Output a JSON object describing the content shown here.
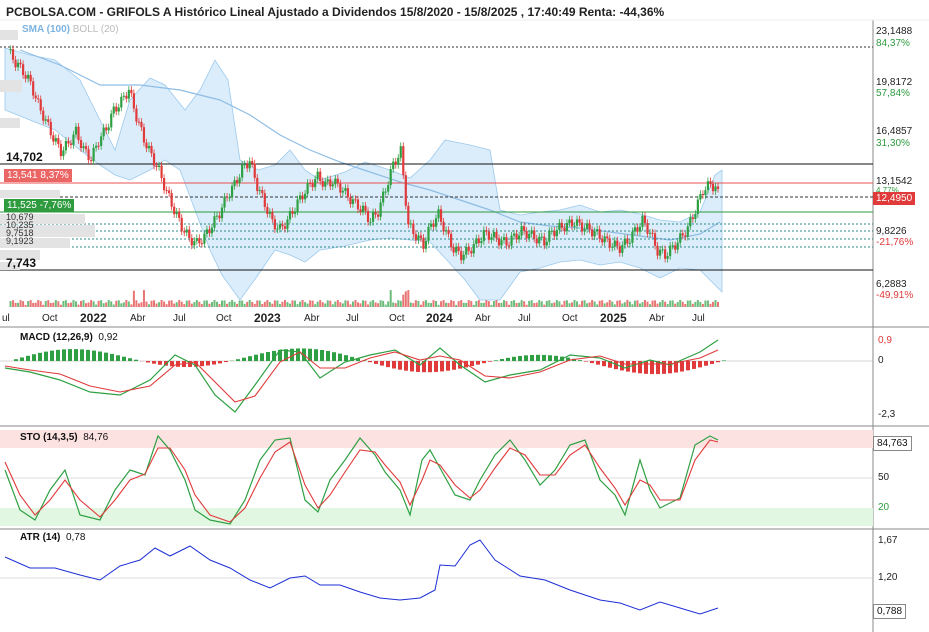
{
  "title": "PCBOLSA.COM - GRIFOLS A Histórico Lineal Ajustado a Dividendos 15/8/2020 - 15/8/2025 , 17:40:49 Renta: -44,36%",
  "overlay_legend": {
    "sma": "SMA (100)",
    "boll": "BOLL (20)"
  },
  "price_axis": [
    {
      "value": "23,1488",
      "pct": "84,37%",
      "pct_color": "#2e9b3e"
    },
    {
      "value": "19,8172",
      "pct": "57,84%",
      "pct_color": "#2e9b3e"
    },
    {
      "value": "16,4857",
      "pct": "31,30%",
      "pct_color": "#2e9b3e"
    },
    {
      "value": "13,1542",
      "pct": "4,77%",
      "pct_color": "#2e9b3e"
    },
    {
      "value": "9,8226",
      "pct": "-21,76%",
      "pct_color": "#e03a3a"
    },
    {
      "value": "6,2883",
      "pct": "-49,91%",
      "pct_color": "#e03a3a"
    }
  ],
  "last_price": "12,4950",
  "levels": {
    "high": "14,702",
    "low": "7,743",
    "red_box": "13,541  8,37%",
    "green_box": "11,525  -7,76%",
    "fib1": "10,679",
    "fib2": "10,235",
    "fib3": "9,7518",
    "fib4": "9,1923"
  },
  "x_axis": [
    "ul",
    "Oct",
    "2022",
    "Abr",
    "Jul",
    "Oct",
    "2023",
    "Abr",
    "Jul",
    "Oct",
    "2024",
    "Abr",
    "Jul",
    "Oct",
    "2025",
    "Abr",
    "Jul"
  ],
  "x_axis_years": [
    "2022",
    "2023",
    "2024",
    "2025"
  ],
  "macd": {
    "label": "MACD (12,26,9)",
    "value": "0,92",
    "axis": [
      "0,9",
      "0",
      "-2,3"
    ]
  },
  "sto": {
    "label": "STO (14,3,5)",
    "value": "84,76",
    "axis": [
      "50",
      "20"
    ],
    "last": "84,763"
  },
  "atr": {
    "label": "ATR (14)",
    "value": "0,78",
    "axis": [
      "1,67",
      "1,20"
    ],
    "last": "0,788"
  },
  "colors": {
    "up": "#2ea043",
    "down": "#e03a3a",
    "band": "#cfe6f8",
    "sma": "#7cb3e0",
    "grid": "#cccccc"
  },
  "chart_data": {
    "type": "candlestick",
    "series": [
      {
        "name": "GRIFOLS A",
        "values": [
          21.8,
          21.0,
          20.4,
          19.6,
          18.2,
          17.1,
          16.0,
          15.1,
          15.6,
          16.4,
          15.2,
          14.6,
          15.8,
          16.6,
          17.8,
          18.4,
          19.2,
          17.4,
          15.9,
          14.8,
          13.8,
          12.4,
          11.2,
          10.1,
          9.3,
          9.0,
          9.4,
          10.2,
          11.0,
          12.1,
          12.9,
          13.9,
          14.5,
          12.8,
          11.6,
          10.4,
          9.9,
          10.5,
          11.4,
          12.2,
          12.9,
          13.4,
          12.9,
          13.1,
          12.7,
          12.1,
          11.6,
          11.2,
          10.5,
          11.1,
          12.6,
          14.2,
          15.1,
          10.2,
          9.5,
          8.9,
          10.2,
          10.9,
          9.7,
          8.6,
          8.2,
          8.5,
          9.0,
          9.6,
          9.5,
          9.2,
          9.0,
          9.4,
          9.8,
          9.6,
          9.3,
          9.1,
          9.7,
          10.0,
          10.2,
          10.4,
          10.1,
          9.9,
          9.6,
          9.2,
          8.9,
          8.7,
          9.1,
          9.8,
          10.5,
          9.7,
          8.5,
          8.2,
          8.7,
          9.3,
          10.0,
          11.2,
          12.5,
          12.9,
          12.6
        ]
      }
    ]
  }
}
